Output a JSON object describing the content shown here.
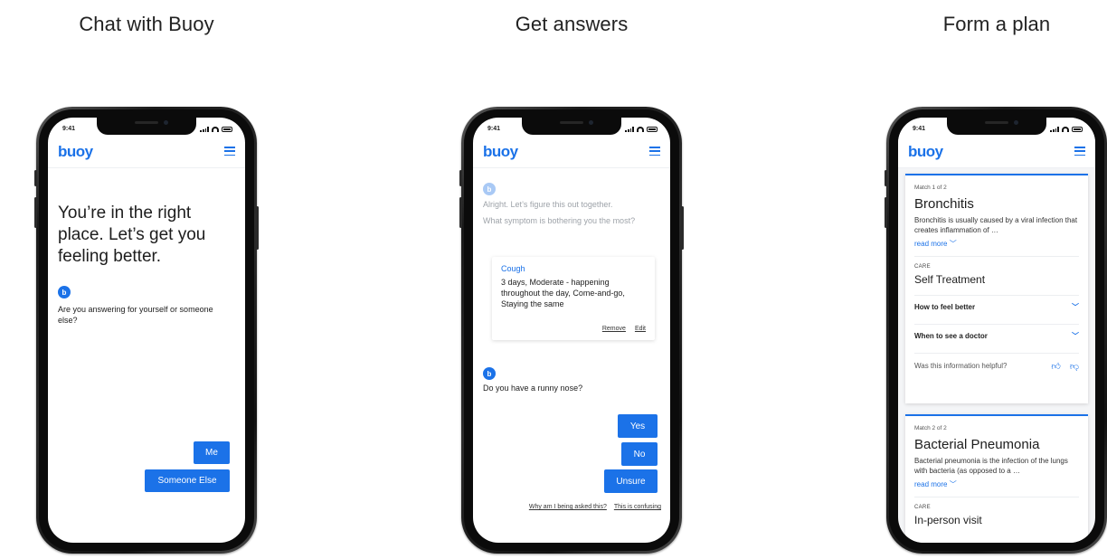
{
  "columns": [
    {
      "title": "Chat with Buoy"
    },
    {
      "title": "Get answers"
    },
    {
      "title": "Form a plan"
    }
  ],
  "status": {
    "time": "9:41"
  },
  "app": {
    "logo": "buoy",
    "avatar_letter": "b",
    "accent": "#1b72e8"
  },
  "chat": {
    "headline": "You’re in the right place. Let’s get you feeling better.",
    "question": "Are you answering for yourself or someone else?",
    "options": [
      "Me",
      "Someone Else"
    ]
  },
  "answers": {
    "intro": "Alright. Let’s figure this out together.",
    "prompt": "What symptom is bothering you the most?",
    "card": {
      "title": "Cough",
      "body": "3 days, Moderate - happening throughout the day, Come-and-go, Staying the same",
      "remove": "Remove",
      "edit": "Edit"
    },
    "question": "Do you have a runny nose?",
    "options": [
      "Yes",
      "No",
      "Unsure"
    ],
    "why_link": "Why am I being asked this?",
    "confusing_link": "This is confusing"
  },
  "plan": {
    "match1": {
      "label": "Match 1 of 2",
      "condition": "Bronchitis",
      "description": "Bronchitis is usually caused by a viral infection that creates inflammation of …",
      "read_more": "read more",
      "care_label": "CARE",
      "care": "Self Treatment",
      "rows": [
        "How to feel better",
        "When to see a doctor"
      ],
      "helpful": "Was this information helpful?"
    },
    "match2": {
      "label": "Match 2 of 2",
      "condition": "Bacterial Pneumonia",
      "description": "Bacterial pneumonia is the infection of the lungs with bacteria (as opposed to a …",
      "read_more": "read more",
      "care_label": "CARE",
      "care": "In-person visit"
    }
  }
}
